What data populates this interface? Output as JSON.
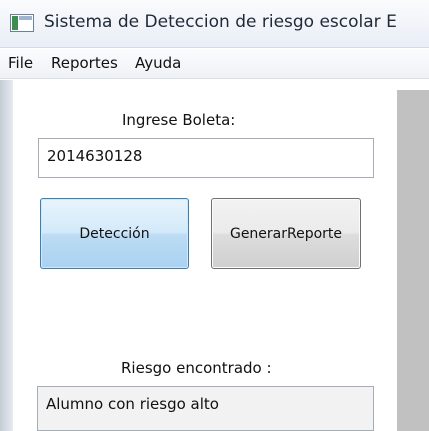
{
  "window": {
    "title": "Sistema de Deteccion de riesgo escolar E",
    "icon": "application-window-icon"
  },
  "menubar": {
    "items": [
      "File",
      "Reportes",
      "Ayuda"
    ]
  },
  "form": {
    "boleta_label": "Ingrese Boleta:",
    "boleta_value": "2014630128",
    "detect_button": "Detección",
    "report_button": "GenerarReporte",
    "result_label": "Riesgo encontrado :",
    "result_value": "Alumno con riesgo alto"
  },
  "colors": {
    "primary_button_border": "#3c7fb1",
    "right_panel": "#c1c1c1"
  }
}
